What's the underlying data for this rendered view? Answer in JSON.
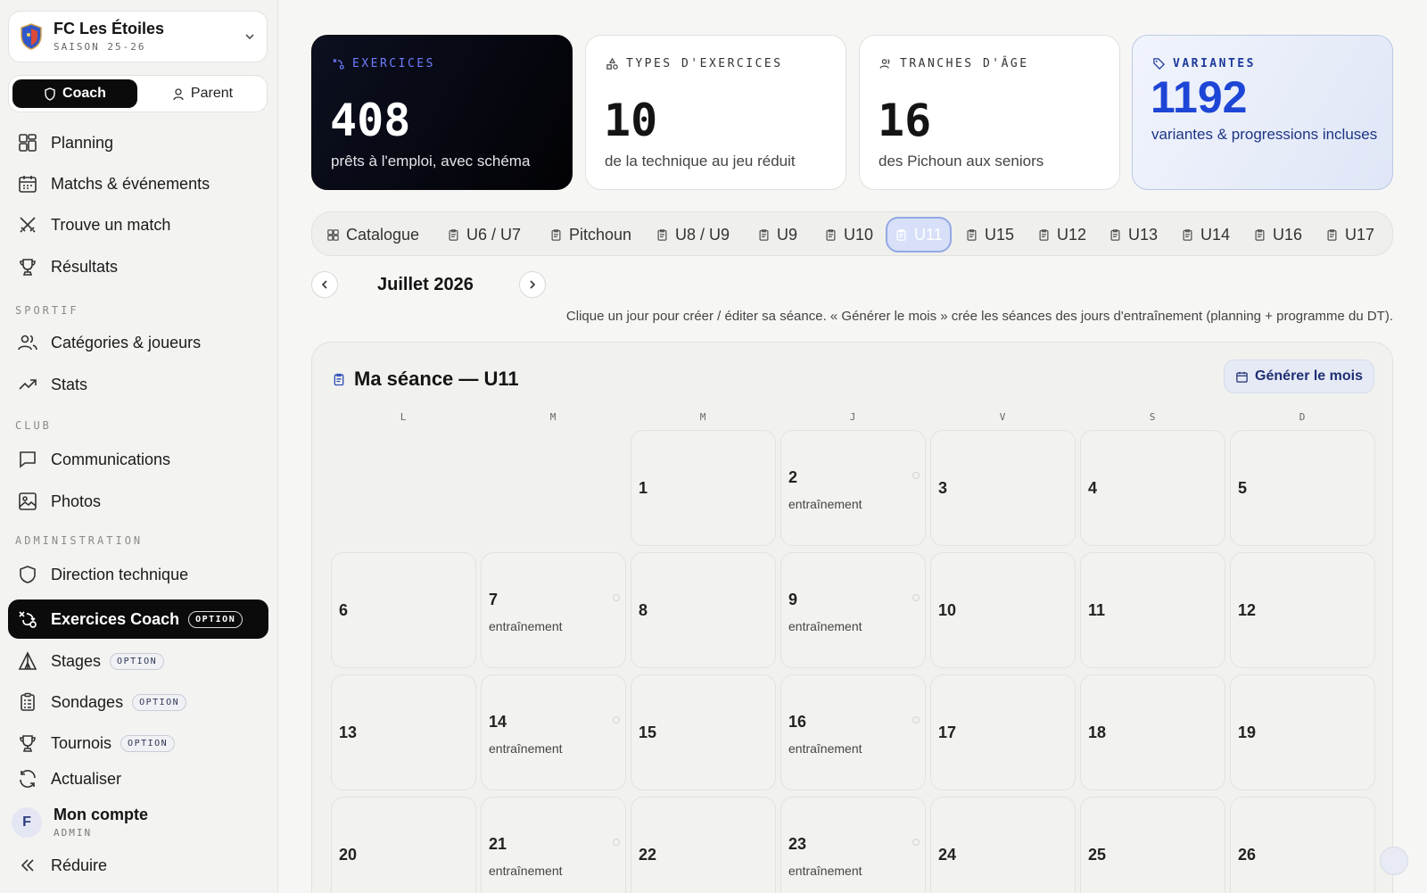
{
  "club": {
    "name": "FC Les Étoiles",
    "season": "SAISON 25-26"
  },
  "roles": {
    "coach": "Coach",
    "parent": "Parent"
  },
  "nav": {
    "planning": "Planning",
    "matchs": "Matchs & événements",
    "trouve": "Trouve un match",
    "resultats": "Résultats",
    "section_sportif": "SPORTIF",
    "categories": "Catégories & joueurs",
    "stats": "Stats",
    "section_club": "CLUB",
    "communications": "Communications",
    "photos": "Photos",
    "section_admin": "ADMINISTRATION",
    "direction": "Direction technique",
    "exercices": "Exercices Coach",
    "stages": "Stages",
    "sondages": "Sondages",
    "tournois": "Tournois",
    "option_badge": "OPTION",
    "actualiser": "Actualiser",
    "reduire": "Réduire"
  },
  "account": {
    "initial": "F",
    "name": "Mon compte",
    "role": "ADMIN"
  },
  "stats": [
    {
      "label": "EXERCICES",
      "value": "408",
      "desc": "prêts à l'emploi, avec schéma"
    },
    {
      "label": "TYPES D'EXERCICES",
      "value": "10",
      "desc": "de la technique au jeu réduit"
    },
    {
      "label": "TRANCHES D'ÂGE",
      "value": "16",
      "desc": "des Pichoun aux seniors"
    },
    {
      "label": "VARIANTES",
      "value": "1192",
      "desc": "variantes & progressions incluses"
    }
  ],
  "tabs": [
    "Catalogue",
    "U6 / U7",
    "Pitchoun",
    "U8 / U9",
    "U9",
    "U10",
    "U11",
    "U15",
    "U12",
    "U13",
    "U14",
    "U16",
    "U17"
  ],
  "active_tab": "U11",
  "calendar": {
    "month": "Juillet 2026",
    "hint": "Clique un jour pour créer / éditer sa séance. « Générer le mois » crée les séances des jours d'entraînement (planning + programme du DT).",
    "title": "Ma séance — U11",
    "generate": "Générer le mois",
    "weekdays": [
      "L",
      "M",
      "M",
      "J",
      "V",
      "S",
      "D"
    ],
    "session_label": "entraînement",
    "days": [
      {
        "n": "1",
        "session": false
      },
      {
        "n": "2",
        "session": true
      },
      {
        "n": "3",
        "session": false
      },
      {
        "n": "4",
        "session": false
      },
      {
        "n": "5",
        "session": false
      },
      {
        "n": "6",
        "session": false
      },
      {
        "n": "7",
        "session": true
      },
      {
        "n": "8",
        "session": false
      },
      {
        "n": "9",
        "session": true
      },
      {
        "n": "10",
        "session": false
      },
      {
        "n": "11",
        "session": false
      },
      {
        "n": "12",
        "session": false
      },
      {
        "n": "13",
        "session": false
      },
      {
        "n": "14",
        "session": true
      },
      {
        "n": "15",
        "session": false
      },
      {
        "n": "16",
        "session": true
      },
      {
        "n": "17",
        "session": false
      },
      {
        "n": "18",
        "session": false
      },
      {
        "n": "19",
        "session": false
      },
      {
        "n": "20",
        "session": false
      },
      {
        "n": "21",
        "session": true
      },
      {
        "n": "22",
        "session": false
      },
      {
        "n": "23",
        "session": true
      },
      {
        "n": "24",
        "session": false
      },
      {
        "n": "25",
        "session": false
      },
      {
        "n": "26",
        "session": false
      }
    ]
  },
  "colors": {
    "accent": "#1e46d6",
    "dark": "#0b0b0b"
  }
}
